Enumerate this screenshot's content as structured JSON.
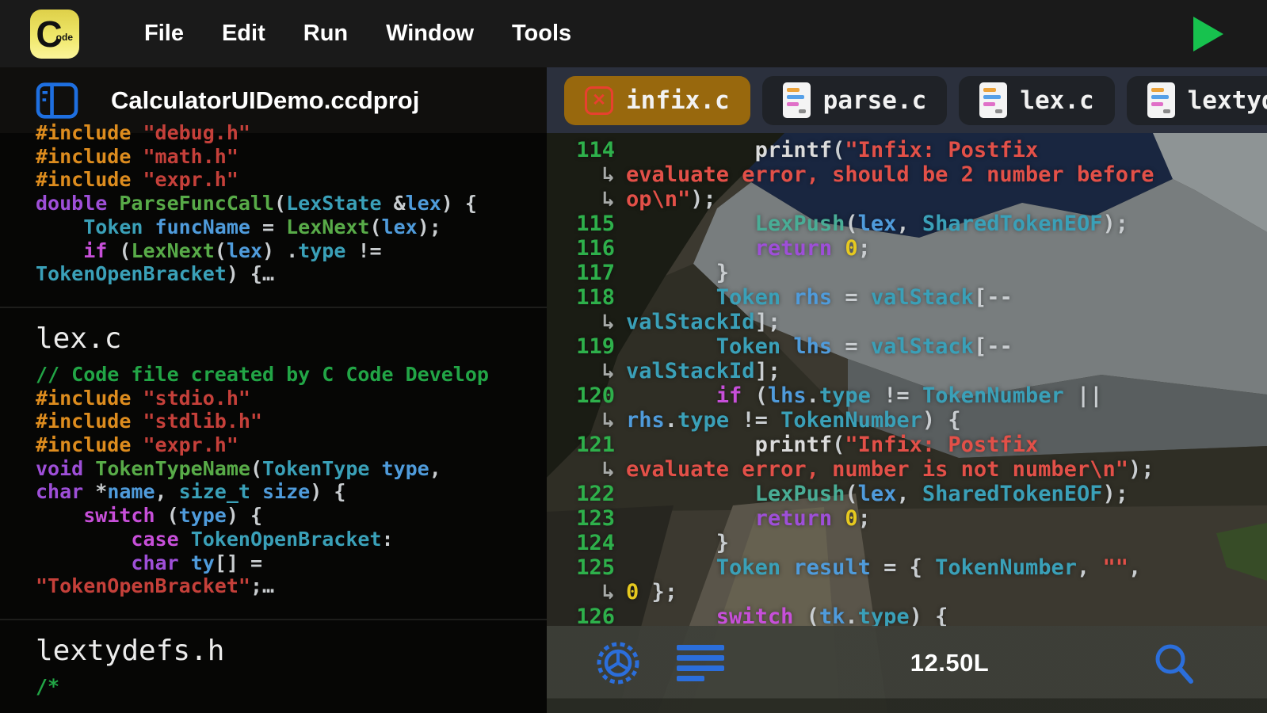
{
  "app": {
    "icon_big": "C",
    "icon_small": "ode"
  },
  "menu_bar": {
    "items": [
      "File",
      "Edit",
      "Run",
      "Window",
      "Tools"
    ]
  },
  "sidebar": {
    "title": "CalculatorUIDemo.ccdproj",
    "sections": [
      {
        "header": null,
        "lines": [
          [
            [
              "pp",
              "#include "
            ],
            [
              "s",
              "\"debug.h\""
            ]
          ],
          [
            [
              "pp",
              "#include "
            ],
            [
              "s",
              "\"math.h\""
            ]
          ],
          [
            [
              "pp",
              "#include "
            ],
            [
              "s",
              "\"expr.h\""
            ]
          ],
          [
            [
              "k",
              "double "
            ],
            [
              "fn",
              "ParseFuncCall"
            ],
            [
              "p",
              "("
            ],
            [
              "ty",
              "LexState"
            ],
            [
              "p",
              " &"
            ],
            [
              "v",
              "lex"
            ],
            [
              "p",
              ") {"
            ]
          ],
          [
            [
              "p",
              "    "
            ],
            [
              "ty",
              "Token"
            ],
            [
              "v",
              " funcName"
            ],
            [
              "p",
              " = "
            ],
            [
              "fn",
              "LexNext"
            ],
            [
              "p",
              "("
            ],
            [
              "v",
              "lex"
            ],
            [
              "p",
              ");"
            ]
          ],
          [
            [
              "p",
              "    "
            ],
            [
              "kb",
              "if"
            ],
            [
              "p",
              " ("
            ],
            [
              "fn",
              "LexNext"
            ],
            [
              "p",
              "("
            ],
            [
              "v",
              "lex"
            ],
            [
              "p",
              ") ."
            ],
            [
              "ty",
              "type"
            ],
            [
              "p",
              " !="
            ]
          ],
          [
            [
              "ty",
              "TokenOpenBracket"
            ],
            [
              "p",
              ") {…"
            ]
          ]
        ]
      },
      {
        "header": "lex.c",
        "lines": [
          [
            [
              "c",
              "// Code file created by C Code Develop"
            ]
          ],
          [
            [
              "pp",
              "#include "
            ],
            [
              "s",
              "\"stdio.h\""
            ]
          ],
          [
            [
              "pp",
              "#include "
            ],
            [
              "s",
              "\"stdlib.h\""
            ]
          ],
          [
            [
              "pp",
              "#include "
            ],
            [
              "s",
              "\"expr.h\""
            ]
          ],
          [
            [
              "k",
              "void "
            ],
            [
              "fn",
              "TokenTypeName"
            ],
            [
              "p",
              "("
            ],
            [
              "ty",
              "TokenType"
            ],
            [
              "v",
              " type"
            ],
            [
              "p",
              ","
            ]
          ],
          [
            [
              "k",
              "char"
            ],
            [
              "p",
              " *"
            ],
            [
              "v",
              "name"
            ],
            [
              "p",
              ", "
            ],
            [
              "ty",
              "size_t"
            ],
            [
              "v",
              " size"
            ],
            [
              "p",
              ") {"
            ]
          ],
          [
            [
              "p",
              "    "
            ],
            [
              "kb",
              "switch"
            ],
            [
              "p",
              " ("
            ],
            [
              "v",
              "type"
            ],
            [
              "p",
              ") {"
            ]
          ],
          [
            [
              "p",
              "        "
            ],
            [
              "kb",
              "case "
            ],
            [
              "ty",
              "TokenOpenBracket"
            ],
            [
              "p",
              ":"
            ]
          ],
          [
            [
              "p",
              "        "
            ],
            [
              "k",
              "char "
            ],
            [
              "v",
              "ty"
            ],
            [
              "p",
              "[] ="
            ]
          ],
          [
            [
              "s",
              "\"TokenOpenBracket\""
            ],
            [
              "p",
              ";…"
            ]
          ]
        ]
      },
      {
        "header": "lextydefs.h",
        "lines": [
          [
            [
              "c",
              "/*"
            ]
          ]
        ]
      }
    ]
  },
  "tabs": [
    {
      "label": "infix.c",
      "active": true
    },
    {
      "label": "parse.c",
      "active": false
    },
    {
      "label": "lex.c",
      "active": false
    },
    {
      "label": "lextydefs.h",
      "active": false
    }
  ],
  "editor": {
    "wrap_marker": "↳",
    "rows": [
      {
        "gutter": "114",
        "indent": 10,
        "segs": [
          [
            "pr",
            "printf"
          ],
          [
            "p",
            "("
          ],
          [
            "s2",
            "\"Infix: Postfix"
          ]
        ]
      },
      {
        "gutter": "wrap",
        "indent": 0,
        "segs": [
          [
            "s2",
            "evaluate error, should be 2 number before"
          ]
        ]
      },
      {
        "gutter": "wrap",
        "indent": 0,
        "segs": [
          [
            "s2",
            "op\\n\""
          ],
          [
            "p",
            ");"
          ]
        ]
      },
      {
        "gutter": "115",
        "indent": 10,
        "segs": [
          [
            "te",
            "LexPush"
          ],
          [
            "p",
            "("
          ],
          [
            "v",
            "lex"
          ],
          [
            "p",
            ", "
          ],
          [
            "ty",
            "SharedTokenEOF"
          ],
          [
            "p",
            ");"
          ]
        ]
      },
      {
        "gutter": "116",
        "indent": 10,
        "segs": [
          [
            "k",
            "return "
          ],
          [
            "n",
            "0"
          ],
          [
            "p",
            ";"
          ]
        ]
      },
      {
        "gutter": "117",
        "indent": 7,
        "segs": [
          [
            "p",
            "}"
          ]
        ]
      },
      {
        "gutter": "118",
        "indent": 7,
        "segs": [
          [
            "ty",
            "Token"
          ],
          [
            "v",
            " rhs"
          ],
          [
            "p",
            " = "
          ],
          [
            "ty",
            "valStack"
          ],
          [
            "p",
            "[--"
          ]
        ]
      },
      {
        "gutter": "wrap",
        "indent": 0,
        "segs": [
          [
            "ty",
            "valStackId"
          ],
          [
            "p",
            "];"
          ]
        ]
      },
      {
        "gutter": "119",
        "indent": 7,
        "segs": [
          [
            "ty",
            "Token"
          ],
          [
            "v",
            " lhs"
          ],
          [
            "p",
            " = "
          ],
          [
            "ty",
            "valStack"
          ],
          [
            "p",
            "[--"
          ]
        ]
      },
      {
        "gutter": "wrap",
        "indent": 0,
        "segs": [
          [
            "ty",
            "valStackId"
          ],
          [
            "p",
            "];"
          ]
        ]
      },
      {
        "gutter": "120",
        "indent": 7,
        "segs": [
          [
            "kb",
            "if"
          ],
          [
            "p",
            " ("
          ],
          [
            "v",
            "lhs"
          ],
          [
            "p",
            "."
          ],
          [
            "ty",
            "type"
          ],
          [
            "p",
            " != "
          ],
          [
            "ty",
            "TokenNumber"
          ],
          [
            "p",
            " ||"
          ]
        ]
      },
      {
        "gutter": "wrap",
        "indent": 0,
        "segs": [
          [
            "v",
            "rhs"
          ],
          [
            "p",
            "."
          ],
          [
            "ty",
            "type"
          ],
          [
            "p",
            " != "
          ],
          [
            "ty",
            "TokenNumber"
          ],
          [
            "p",
            ") {"
          ]
        ]
      },
      {
        "gutter": "121",
        "indent": 10,
        "segs": [
          [
            "pr",
            "printf"
          ],
          [
            "p",
            "("
          ],
          [
            "s2",
            "\"Infix: Postfix"
          ]
        ]
      },
      {
        "gutter": "wrap",
        "indent": 0,
        "segs": [
          [
            "s2",
            "evaluate error, number is not number\\n\""
          ],
          [
            "p",
            ");"
          ]
        ]
      },
      {
        "gutter": "122",
        "indent": 10,
        "segs": [
          [
            "te",
            "LexPush"
          ],
          [
            "p",
            "("
          ],
          [
            "v",
            "lex"
          ],
          [
            "p",
            ", "
          ],
          [
            "ty",
            "SharedTokenEOF"
          ],
          [
            "p",
            ");"
          ]
        ]
      },
      {
        "gutter": "123",
        "indent": 10,
        "segs": [
          [
            "k",
            "return "
          ],
          [
            "n",
            "0"
          ],
          [
            "p",
            ";"
          ]
        ]
      },
      {
        "gutter": "124",
        "indent": 7,
        "segs": [
          [
            "p",
            "}"
          ]
        ]
      },
      {
        "gutter": "125",
        "indent": 7,
        "segs": [
          [
            "ty",
            "Token"
          ],
          [
            "v",
            " result"
          ],
          [
            "p",
            " = { "
          ],
          [
            "ty",
            "TokenNumber"
          ],
          [
            "p",
            ", "
          ],
          [
            "s2",
            "\"\""
          ],
          [
            "p",
            ","
          ]
        ]
      },
      {
        "gutter": "wrap",
        "indent": 0,
        "segs": [
          [
            "n",
            "0"
          ],
          [
            "p",
            " };"
          ]
        ]
      },
      {
        "gutter": "126",
        "indent": 7,
        "segs": [
          [
            "kb",
            "switch"
          ],
          [
            "p",
            " ("
          ],
          [
            "v",
            "tk"
          ],
          [
            "p",
            "."
          ],
          [
            "ty",
            "type"
          ],
          [
            "p",
            ") {"
          ]
        ]
      }
    ]
  },
  "status_bar": {
    "line_info": "12.50L"
  },
  "colors": {
    "accent_blue": "#2b6edb",
    "tab_active": "#98680d",
    "close_red": "#e8402f",
    "run_green": "#17c24e",
    "line_number_green": "#2eb04b"
  }
}
